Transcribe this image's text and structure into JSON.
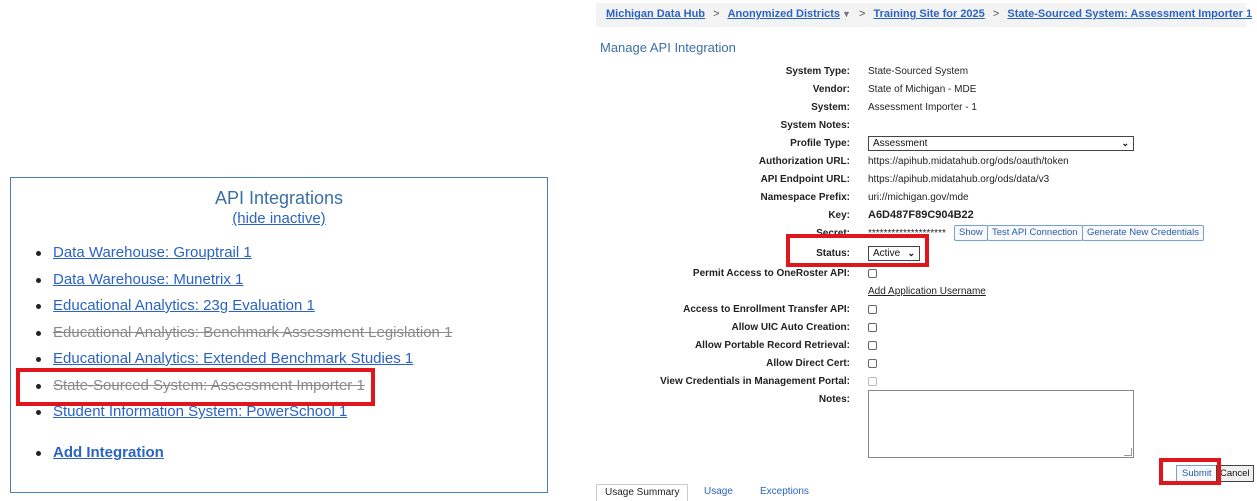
{
  "breadcrumb": [
    {
      "label": "Michigan Data Hub",
      "dropdown": false
    },
    {
      "label": "Anonymized Districts",
      "dropdown": true
    },
    {
      "label": "Training Site for 2025",
      "dropdown": false
    },
    {
      "label": "State-Sourced System: Assessment Importer 1",
      "dropdown": false
    }
  ],
  "breadcrumb_separator": ">",
  "page_title": "Manage API Integration",
  "api_panel": {
    "title": "API Integrations",
    "hide_inactive": "(hide inactive)",
    "items": [
      {
        "label": "Data Warehouse: Grouptrail 1",
        "inactive": false
      },
      {
        "label": "Data Warehouse: Munetrix 1",
        "inactive": false
      },
      {
        "label": "Educational Analytics: 23g Evaluation 1",
        "inactive": false
      },
      {
        "label": "Educational Analytics: Benchmark Assessment Legislation 1",
        "inactive": true
      },
      {
        "label": "Educational Analytics: Extended Benchmark Studies 1",
        "inactive": false
      },
      {
        "label": "State-Sourced System: Assessment Importer 1",
        "inactive": true
      },
      {
        "label": "Student Information System: PowerSchool 1",
        "inactive": false
      }
    ],
    "add_label": "Add Integration"
  },
  "form": {
    "system_type": {
      "label": "System Type:",
      "value": "State-Sourced System"
    },
    "vendor": {
      "label": "Vendor:",
      "value": "State of Michigan - MDE"
    },
    "system": {
      "label": "System:",
      "value": "Assessment Importer - 1"
    },
    "system_notes": {
      "label": "System Notes:",
      "value": ""
    },
    "profile_type": {
      "label": "Profile Type:",
      "value": "Assessment"
    },
    "authorization_url": {
      "label": "Authorization URL:",
      "value": "https://apihub.midatahub.org/ods/oauth/token"
    },
    "api_endpoint_url": {
      "label": "API Endpoint URL:",
      "value": "https://apihub.midatahub.org/ods/data/v3"
    },
    "namespace_prefix": {
      "label": "Namespace Prefix:",
      "value": "uri://michigan.gov/mde"
    },
    "key": {
      "label": "Key:",
      "value": "A6D487F89C904B22"
    },
    "secret": {
      "label": "Secret:",
      "value": "********************"
    },
    "show_button": "Show",
    "test_button": "Test API Connection",
    "generate_button": "Generate New Credentials",
    "status": {
      "label": "Status:",
      "value": "Active"
    },
    "oneroster": {
      "label": "Permit Access to OneRoster API:",
      "checked": false
    },
    "add_app_username": "Add Application Username",
    "enrollment_transfer": {
      "label": "Access to Enrollment Transfer API:",
      "checked": false
    },
    "uic_auto": {
      "label": "Allow UIC Auto Creation:",
      "checked": false
    },
    "portable_record": {
      "label": "Allow Portable Record Retrieval:",
      "checked": false
    },
    "direct_cert": {
      "label": "Allow Direct Cert:",
      "checked": false
    },
    "view_credentials": {
      "label": "View Credentials in Management Portal:",
      "checked": false,
      "disabled": true
    },
    "notes": {
      "label": "Notes:",
      "value": ""
    },
    "submit_button": "Submit",
    "cancel_button": "Cancel"
  },
  "tabs": [
    {
      "label": "Usage Summary",
      "active": true
    },
    {
      "label": "Usage",
      "active": false
    },
    {
      "label": "Exceptions",
      "active": false
    }
  ],
  "colors": {
    "link": "#2a63c5",
    "title": "#3b6fa5",
    "highlight": "#e0161d",
    "panel_border": "#4a7fb5",
    "inactive_text": "#8a8a8a"
  }
}
